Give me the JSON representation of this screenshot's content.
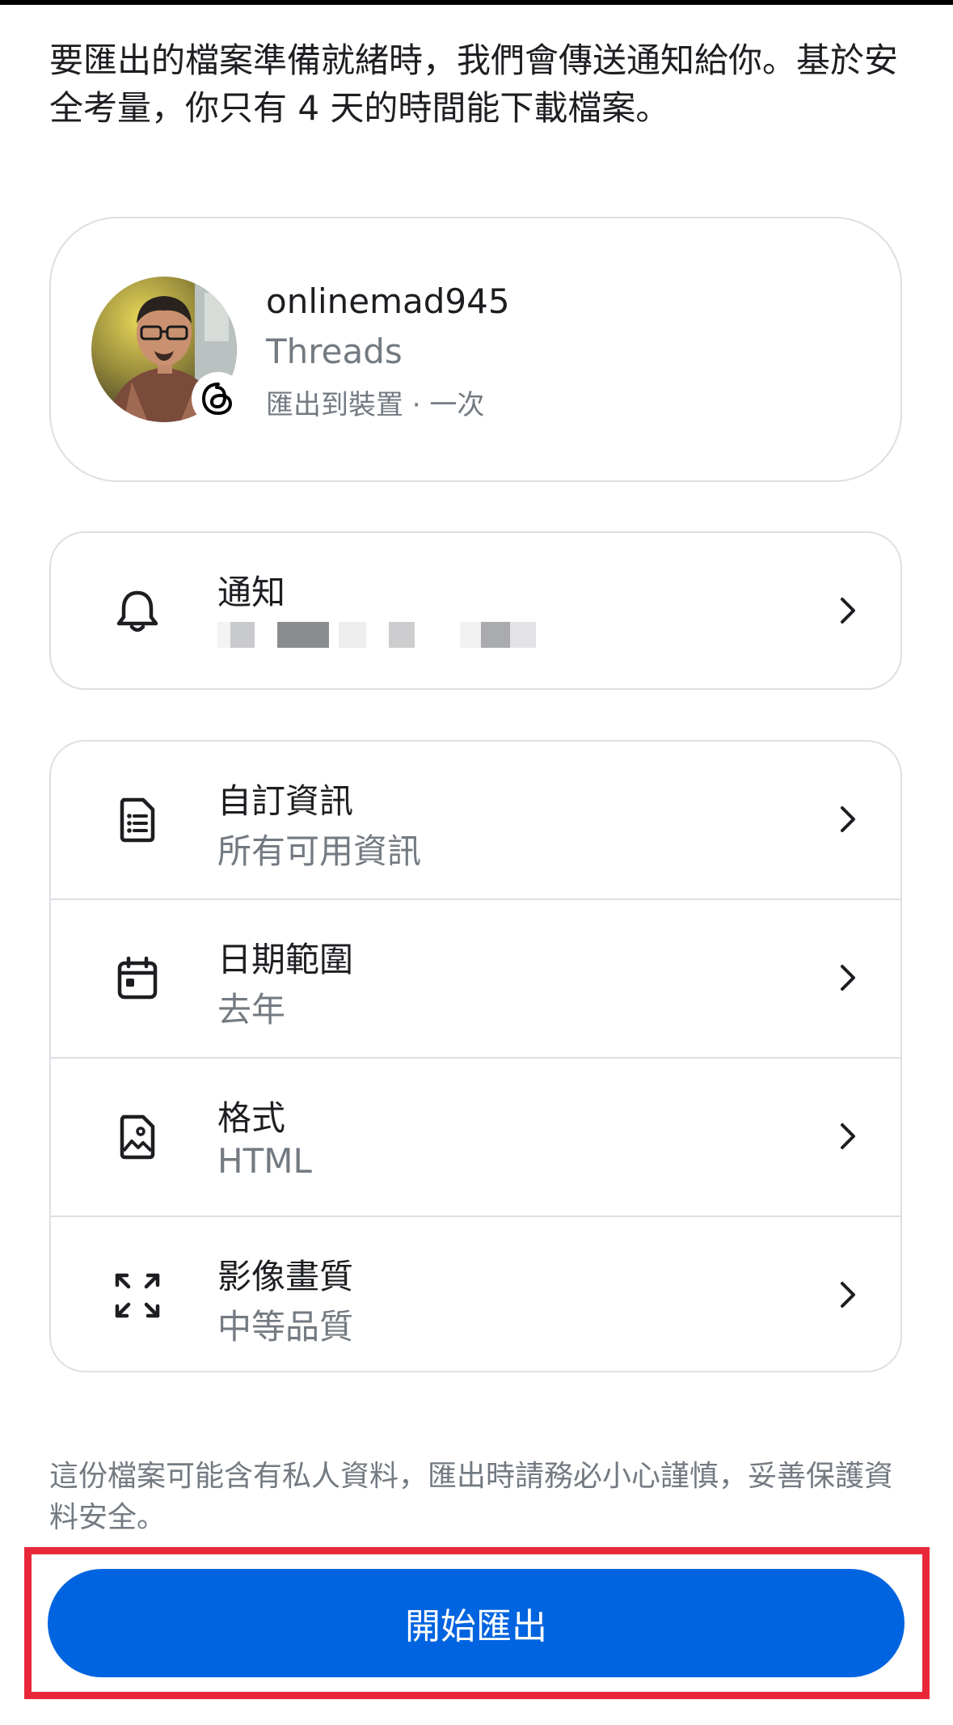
{
  "intro_text": "要匯出的檔案準備就緒時，我們會傳送通知給你。基於安全考量，你只有 4 天的時間能下載檔案。",
  "account": {
    "username": "onlinemad945",
    "app": "Threads",
    "destination": "匯出到裝置 · 一次"
  },
  "notification": {
    "title": "通知",
    "value_redacted": true
  },
  "settings": [
    {
      "title": "自訂資訊",
      "value": "所有可用資訊",
      "icon": "document-list-icon"
    },
    {
      "title": "日期範圍",
      "value": "去年",
      "icon": "calendar-icon"
    },
    {
      "title": "格式",
      "value": "HTML",
      "icon": "file-image-icon"
    },
    {
      "title": "影像畫質",
      "value": "中等品質",
      "icon": "expand-arrows-icon"
    }
  ],
  "disclaimer": "這份檔案可能含有私人資料，匯出時請務必小心謹慎，妥善保護資料安全。",
  "start_button_label": "開始匯出",
  "colors": {
    "primary": "#0064e0",
    "highlight": "#e8283a",
    "secondary_text": "#737a82",
    "border": "#dcdfe3"
  }
}
